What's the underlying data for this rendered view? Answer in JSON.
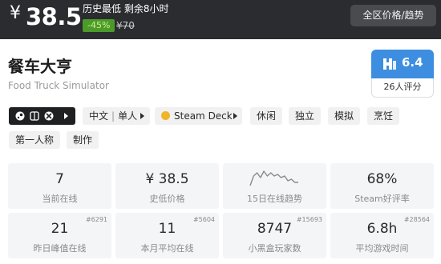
{
  "price_bar": {
    "currency": "¥",
    "price": "38.5",
    "lowest_label": "历史最低 剩余8小时",
    "discount": "-45%",
    "original_price": "¥70",
    "region_button": "全区价格/趋势",
    "colors": {
      "bar_bg": "#2b2c2f",
      "discount_bg": "#4c9a2a",
      "discount_text": "#c9f28a"
    }
  },
  "game": {
    "title": "餐车大亨",
    "subtitle": "Food Truck Simulator"
  },
  "score": {
    "value": "6.4",
    "count_label": "26人评分",
    "logo_icon": "heybox-logo-icon",
    "color": "#3d8ee0"
  },
  "tags": {
    "platform_icons": [
      "steam-icon",
      "switch-icon",
      "xbox-icon"
    ],
    "language": "中文",
    "mode": "单人",
    "steam_deck": "Steam Deck",
    "genres": [
      "休闲",
      "独立",
      "模拟",
      "烹饪"
    ],
    "genres_row2": [
      "第一人称",
      "制作"
    ]
  },
  "stats": {
    "current_online": {
      "value": "7",
      "label": "当前在线"
    },
    "lowest_price": {
      "value": "¥ 38.5",
      "label": "史低价格"
    },
    "trend": {
      "label": "15日在线趋势",
      "points": [
        3,
        9,
        11,
        8,
        12,
        9,
        11,
        9,
        10,
        8,
        9,
        6,
        7,
        5,
        5
      ]
    },
    "steam_rating": {
      "value": "68%",
      "label": "Steam好评率"
    },
    "peak_yesterday": {
      "value": "21",
      "label": "昨日峰值在线",
      "rank": "#6291"
    },
    "monthly_avg": {
      "value": "11",
      "label": "本月平均在线",
      "rank": "#5604"
    },
    "heybox_players": {
      "value": "8747",
      "label": "小黑盒玩家数",
      "rank": "#15693"
    },
    "avg_playtime": {
      "value": "6.8h",
      "label": "平均游戏时间",
      "rank": "#28564"
    }
  }
}
